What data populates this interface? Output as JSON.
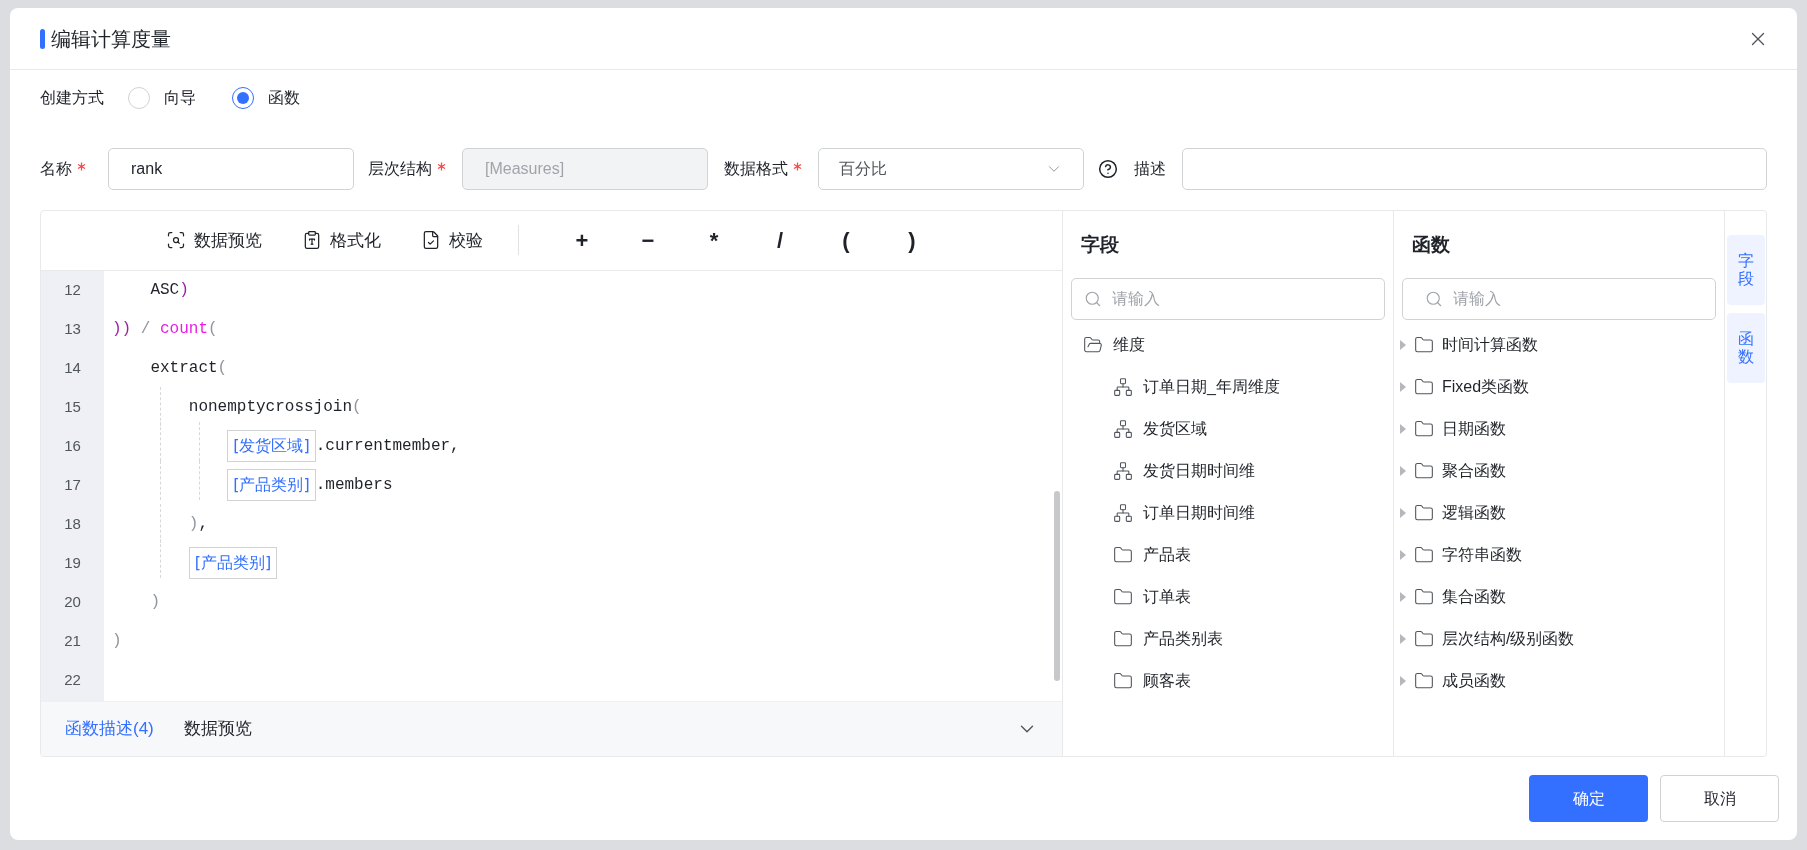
{
  "dialog": {
    "title": "编辑计算度量"
  },
  "creation": {
    "label": "创建方式",
    "options": [
      {
        "label": "向导",
        "selected": false
      },
      {
        "label": "函数",
        "selected": true
      }
    ]
  },
  "form": {
    "name": {
      "label": "名称",
      "required": true,
      "value": "rank"
    },
    "hierarchy": {
      "label": "层次结构",
      "required": true,
      "value": "[Measures]",
      "disabled": true
    },
    "format": {
      "label": "数据格式",
      "required": true,
      "value": "百分比"
    },
    "description": {
      "label": "描述"
    }
  },
  "toolbar": {
    "actions": [
      {
        "label": "数据预览",
        "kind": "preview"
      },
      {
        "label": "格式化",
        "kind": "format"
      },
      {
        "label": "校验",
        "kind": "validate"
      }
    ],
    "operators": [
      "+",
      "−",
      "*",
      "/",
      "(",
      ")"
    ]
  },
  "code_lines": [
    {
      "children": [
        {
          "number": "12",
          "code": [
            {
              "kind": "plain",
              "text": "ASC"
            },
            {
              "kind": "bracket",
              "text": ")"
            }
          ]
        }
      ]
    },
    {
      "number": "13",
      "code": [
        {
          "kind": "bracket",
          "text": "))"
        },
        {
          "kind": "operator",
          "text": " / "
        },
        {
          "kind": "function",
          "text": "count"
        },
        {
          "kind": "operator",
          "text": "("
        }
      ]
    },
    {
      "children": [
        {
          "number": "14",
          "code": [
            {
              "kind": "plain",
              "text": "extract"
            },
            {
              "kind": "operator",
              "text": "("
            }
          ]
        },
        {
          "children": [
            {
              "number": "15",
              "code": [
                {
                  "kind": "plain",
                  "text": "nonemptycrossjoin"
                },
                {
                  "kind": "operator",
                  "text": "("
                }
              ]
            },
            {
              "children": [
                {
                  "number": "16",
                  "code": [
                    {
                      "kind": "field",
                      "text": "[发货区域]"
                    },
                    {
                      "kind": "plain",
                      "text": ".currentmember,"
                    }
                  ]
                },
                {
                  "number": "17",
                  "code": [
                    {
                      "kind": "field",
                      "text": "[产品类别]"
                    },
                    {
                      "kind": "plain",
                      "text": ".members"
                    }
                  ]
                }
              ]
            },
            {
              "number": "18",
              "code": [
                {
                  "kind": "operator",
                  "text": ")"
                },
                {
                  "kind": "plain",
                  "text": ","
                }
              ]
            },
            {
              "number": "19",
              "code": [
                {
                  "kind": "field",
                  "text": "[产品类别]"
                }
              ]
            }
          ]
        },
        {
          "number": "20",
          "code": [
            {
              "kind": "operator",
              "text": ")"
            }
          ]
        }
      ]
    },
    {
      "number": "21",
      "code": [
        {
          "kind": "operator",
          "text": ")"
        }
      ]
    },
    {
      "number": "22"
    }
  ],
  "bottom_tabs": [
    {
      "label": "函数描述(4)",
      "selected": true
    },
    {
      "label": "数据预览",
      "selected": false
    }
  ],
  "fields": {
    "title": "字段",
    "search": {
      "placeholder": "请输入"
    },
    "tree": [
      {
        "label": "维度",
        "kind": "folder",
        "expanded": true,
        "children": [
          {
            "label": "订单日期_年周维度",
            "kind": "hierarchy"
          },
          {
            "label": "发货区域",
            "kind": "hierarchy"
          },
          {
            "label": "发货日期时间维",
            "kind": "hierarchy"
          },
          {
            "label": "订单日期时间维",
            "kind": "hierarchy"
          },
          {
            "label": "产品表",
            "kind": "folder"
          },
          {
            "label": "订单表",
            "kind": "folder"
          },
          {
            "label": "产品类别表",
            "kind": "folder"
          },
          {
            "label": "顾客表",
            "kind": "folder"
          }
        ]
      }
    ]
  },
  "functions": {
    "title": "函数",
    "search": {
      "placeholder": "请输入"
    },
    "groups": [
      {
        "label": "时间计算函数",
        "expanded": false
      },
      {
        "label": "Fixed类函数",
        "expanded": false
      },
      {
        "label": "日期函数",
        "expanded": false
      },
      {
        "label": "聚合函数",
        "expanded": false
      },
      {
        "label": "逻辑函数",
        "expanded": false
      },
      {
        "label": "字符串函数",
        "expanded": false
      },
      {
        "label": "集合函数",
        "expanded": false
      },
      {
        "label": "层次结构/级别函数",
        "expanded": false
      },
      {
        "label": "成员函数",
        "expanded": false
      }
    ]
  },
  "side_tabs": [
    "字段",
    "函数"
  ],
  "buttons": [
    {
      "label": "确定",
      "kind": "primary"
    },
    {
      "label": "取消",
      "kind": "secondary"
    }
  ]
}
